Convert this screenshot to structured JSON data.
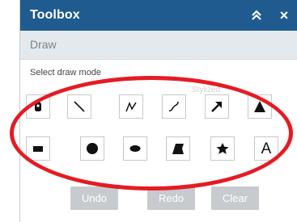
{
  "window": {
    "title": "Toolbox",
    "close_symbol": "×",
    "titlebar_color": "#1f5b8f"
  },
  "panel": {
    "title": "Draw",
    "select_label": "Select draw mode",
    "watermark": "Stylized"
  },
  "tools_row1": [
    {
      "name": "point",
      "icon": "point-icon"
    },
    {
      "name": "line",
      "icon": "line-icon"
    },
    {
      "name": "polyline",
      "icon": "polyline-icon"
    },
    {
      "name": "freehand-polyline",
      "icon": "freehand-line-icon"
    },
    {
      "name": "arrow",
      "icon": "arrow-icon"
    },
    {
      "name": "triangle",
      "icon": "triangle-icon"
    }
  ],
  "tools_row2": [
    {
      "name": "rectangle",
      "icon": "rectangle-icon"
    },
    {
      "name": "circle",
      "icon": "circle-icon"
    },
    {
      "name": "ellipse",
      "icon": "ellipse-icon"
    },
    {
      "name": "polygon",
      "icon": "polygon-icon"
    },
    {
      "name": "freehand-polygon",
      "icon": "freehand-polygon-icon"
    },
    {
      "name": "text",
      "icon": "text-icon",
      "glyph": "A"
    }
  ],
  "actions": {
    "undo_label": "Undo",
    "redo_label": "Redo",
    "clear_label": "Clear"
  },
  "colors": {
    "highlight": "#e51b24",
    "disabled_button": "#c7cbcf"
  }
}
